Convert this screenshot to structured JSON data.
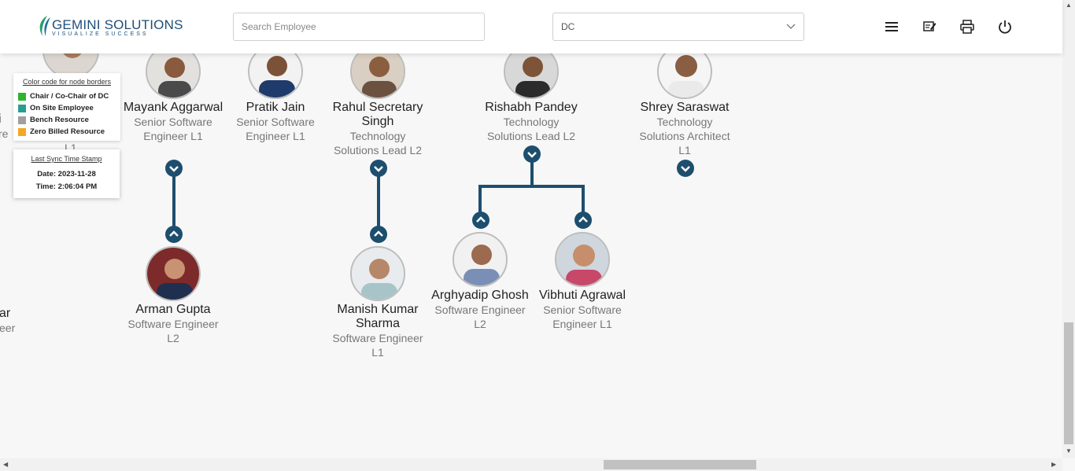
{
  "header": {
    "logo_name": "GEMINI SOLUTIONS",
    "logo_tag": "VISUALIZE SUCCESS",
    "search_placeholder": "Search Employee",
    "dept_selected": "DC",
    "icons": [
      "menu-icon",
      "edit-note-icon",
      "print-icon",
      "power-icon"
    ]
  },
  "legend": {
    "title": "Color code for node borders",
    "items": [
      {
        "label": "Chair / Co-Chair of DC",
        "color": "#2db52d"
      },
      {
        "label": "On Site Employee",
        "color": "#2a9d8f"
      },
      {
        "label": "Bench Resource",
        "color": "#a0a0a0"
      },
      {
        "label": "Zero Billed Resource",
        "color": "#f5a623"
      }
    ]
  },
  "sync": {
    "title": "Last Sync Time Stamp",
    "date": "Date: 2023-11-28",
    "time": "Time: 2:06:04 PM"
  },
  "partial": {
    "left_top": [
      "i",
      "re",
      "L1"
    ],
    "left_bottom": [
      "ar",
      "eer"
    ]
  },
  "nodes": {
    "mayank": {
      "name": "Mayank Aggarwal",
      "role": "Senior Software Engineer L1"
    },
    "pratik": {
      "name": "Pratik Jain",
      "role": "Senior Software Engineer L1"
    },
    "rahul": {
      "name": "Rahul Secretary Singh",
      "role": "Technology Solutions Lead L2"
    },
    "rishabh": {
      "name": "Rishabh Pandey",
      "role": "Technology Solutions Lead L2"
    },
    "shrey": {
      "name": "Shrey Saraswat",
      "role": "Technology Solutions Architect L1"
    },
    "arman": {
      "name": "Arman Gupta",
      "role": "Software Engineer L2"
    },
    "manish": {
      "name": "Manish Kumar Sharma",
      "role": "Software Engineer L1"
    },
    "arghyadip": {
      "name": "Arghyadip Ghosh",
      "role": "Software Engineer L2"
    },
    "vibhuti": {
      "name": "Vibhuti Agrawal",
      "role": "Senior Software Engineer L1"
    }
  },
  "colors": {
    "accent": "#1d4e6e",
    "border": "#bdbdbd"
  }
}
